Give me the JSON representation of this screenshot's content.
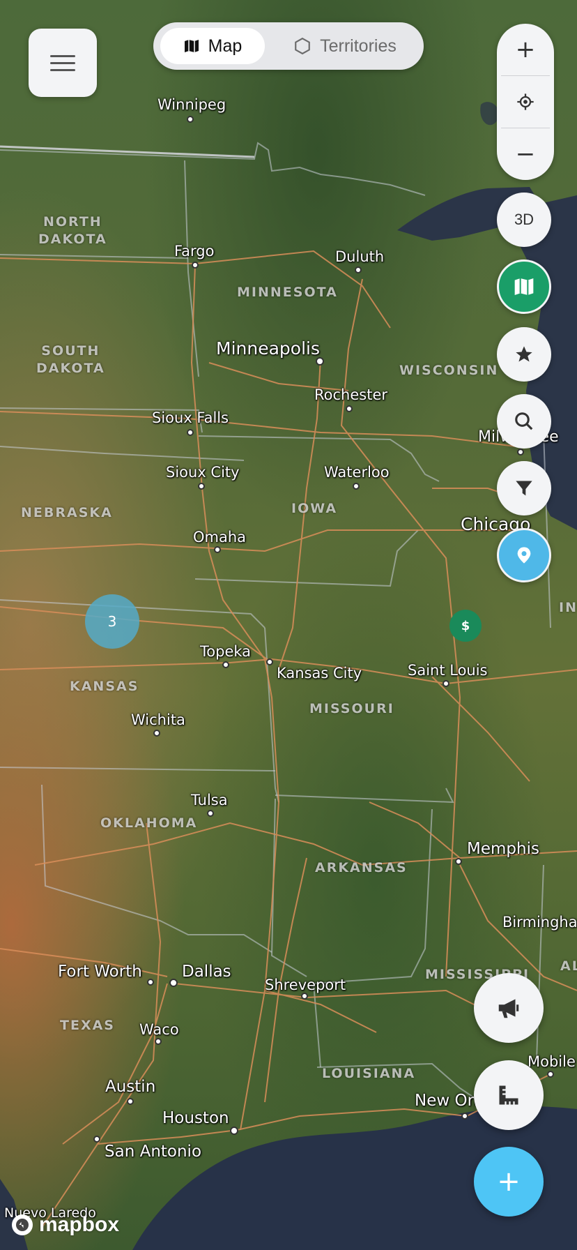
{
  "colors": {
    "accent_green": "#1a9e68",
    "accent_blue": "#4fb8e8",
    "fab_blue": "#4ec5f5",
    "button_bg": "#f3f4f6"
  },
  "menu": {
    "icon": "hamburger-icon"
  },
  "view_toggle": {
    "options": [
      {
        "label": "Map",
        "icon": "map-icon",
        "selected": true
      },
      {
        "label": "Territories",
        "icon": "hexagon-icon",
        "selected": false
      }
    ]
  },
  "zoom_controls": {
    "zoom_in": "+",
    "locate_icon": "crosshair-icon",
    "zoom_out": "−"
  },
  "side_buttons": {
    "three_d_label": "3D",
    "map_layers_icon": "map-icon",
    "favorites_icon": "star-icon",
    "search_icon": "search-icon",
    "filter_icon": "filter-icon",
    "pin_icon": "location-pin-icon"
  },
  "fab": {
    "announce_icon": "megaphone-icon",
    "measure_icon": "ruler-icon",
    "add_label": "+"
  },
  "map": {
    "cluster_count": "3",
    "marker_symbol": "$",
    "attribution": "mapbox",
    "states": [
      {
        "name": "NORTH\nDAKOTA"
      },
      {
        "name": "MINNESOTA"
      },
      {
        "name": "SOUTH\nDAKOTA"
      },
      {
        "name": "WISCONSIN"
      },
      {
        "name": "NEBRASKA"
      },
      {
        "name": "IOWA"
      },
      {
        "name": "KANSAS"
      },
      {
        "name": "MISSOURI"
      },
      {
        "name": "OKLAHOMA"
      },
      {
        "name": "ARKANSAS"
      },
      {
        "name": "MISSISSIPPI"
      },
      {
        "name": "TEXAS"
      },
      {
        "name": "LOUISIANA"
      },
      {
        "name": "IN"
      },
      {
        "name": "AL"
      }
    ],
    "cities": [
      {
        "name": "Winnipeg"
      },
      {
        "name": "Fargo"
      },
      {
        "name": "Duluth"
      },
      {
        "name": "Minneapolis"
      },
      {
        "name": "Rochester"
      },
      {
        "name": "Sioux Falls"
      },
      {
        "name": "Sioux City"
      },
      {
        "name": "Waterloo"
      },
      {
        "name": "Milwaukee"
      },
      {
        "name": "Chicago"
      },
      {
        "name": "Omaha"
      },
      {
        "name": "Topeka"
      },
      {
        "name": "Kansas City"
      },
      {
        "name": "Saint Louis"
      },
      {
        "name": "Wichita"
      },
      {
        "name": "Tulsa"
      },
      {
        "name": "Memphis"
      },
      {
        "name": "Birmingham"
      },
      {
        "name": "Fort Worth"
      },
      {
        "name": "Dallas"
      },
      {
        "name": "Shreveport"
      },
      {
        "name": "Waco"
      },
      {
        "name": "Mobile"
      },
      {
        "name": "Austin"
      },
      {
        "name": "New Orleans"
      },
      {
        "name": "Houston"
      },
      {
        "name": "San Antonio"
      },
      {
        "name": "Nuevo Laredo"
      }
    ]
  }
}
